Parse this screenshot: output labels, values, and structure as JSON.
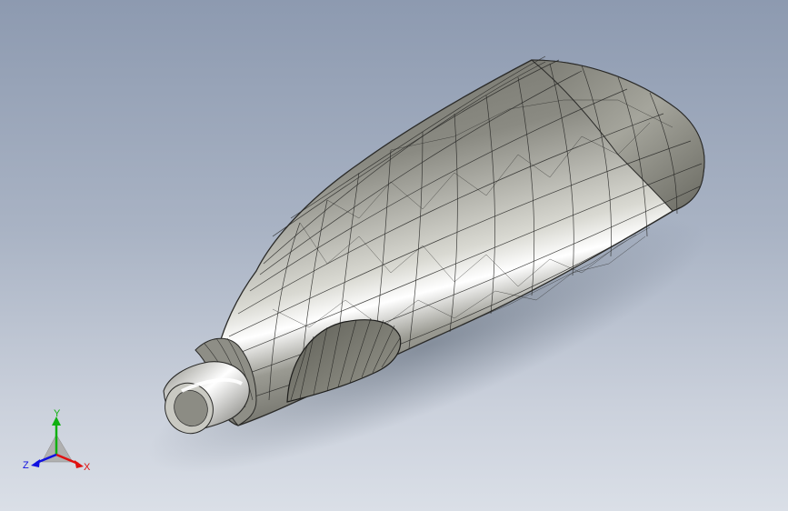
{
  "viewport": {
    "background_top": "#8d9ab0",
    "background_bottom": "#dadfe7",
    "model": {
      "shade_color": "#8c8c84",
      "edge_color": "#1e1e1e",
      "highlight_color": "#ffffff"
    }
  },
  "triad": {
    "x_label": "X",
    "y_label": "Y",
    "z_label": "Z",
    "x_color": "#e01010",
    "y_color": "#10b010",
    "z_color": "#1010e0"
  }
}
